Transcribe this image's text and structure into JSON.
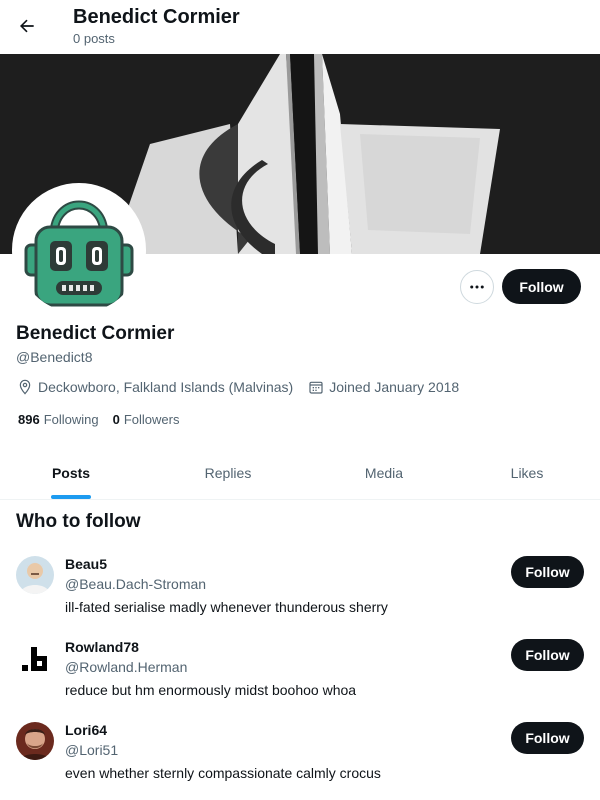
{
  "header": {
    "title": "Benedict Cormier",
    "post_count": "0 posts",
    "back_icon": "back-arrow-icon"
  },
  "profile": {
    "name": "Benedict Cormier",
    "handle": "@Benedict8",
    "location": "Deckowboro, Falkland Islands (Malvinas)",
    "joined": "Joined January 2018",
    "following_count": "896",
    "following_label": "Following",
    "followers_count": "0",
    "followers_label": "Followers",
    "follow_label": "Follow",
    "avatar_icon": "robot-icon",
    "more_icon": "more-icon"
  },
  "tabs": [
    {
      "label": "Posts",
      "active": true
    },
    {
      "label": "Replies",
      "active": false
    },
    {
      "label": "Media",
      "active": false
    },
    {
      "label": "Likes",
      "active": false
    }
  ],
  "who_to_follow": {
    "title": "Who to follow",
    "users": [
      {
        "name": "Beau5",
        "handle": "@Beau.Dach-Stroman",
        "bio": "ill-fated serialise madly whenever thunderous sherry",
        "follow_label": "Follow"
      },
      {
        "name": "Rowland78",
        "handle": "@Rowland.Herman",
        "bio": "reduce but hm enormously midst boohoo whoa",
        "follow_label": "Follow"
      },
      {
        "name": "Lori64",
        "handle": "@Lori51",
        "bio": "even whether sternly compassionate calmly crocus",
        "follow_label": "Follow"
      }
    ]
  },
  "colors": {
    "accent": "#1d9bf0",
    "button_dark": "#0f1419",
    "secondary_text": "#536471",
    "robot_green": "#3aa57f"
  }
}
